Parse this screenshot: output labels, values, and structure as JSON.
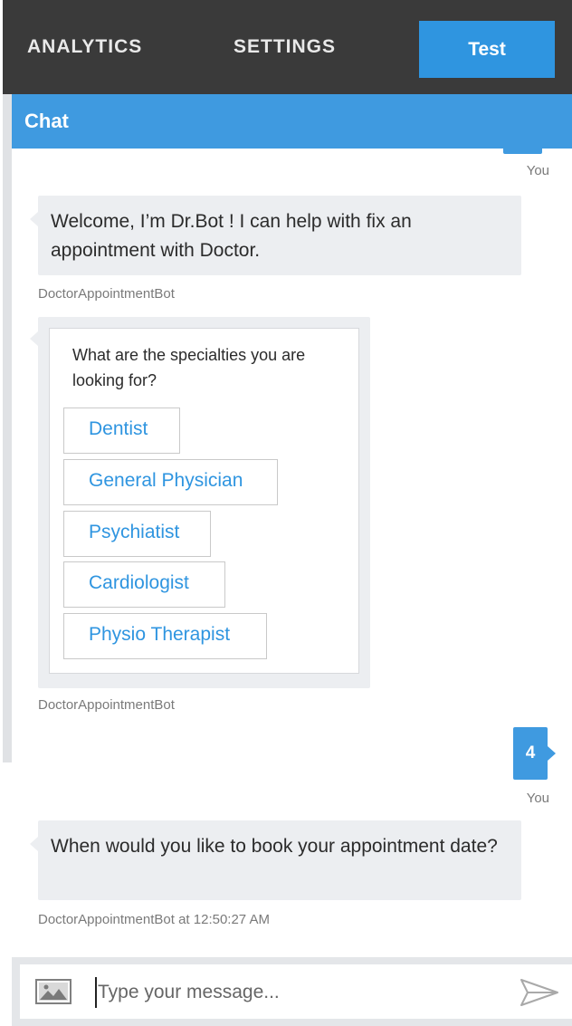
{
  "nav": {
    "analytics_label": "ANALYTICS",
    "settings_label": "SETTINGS",
    "test_label": "Test"
  },
  "chat": {
    "header_title": "Chat",
    "messages": [
      {
        "from": "user",
        "sender_label": "You"
      },
      {
        "from": "bot",
        "text": "Welcome, I’m Dr.Bot ! I can help with fix an appointment with Doctor.",
        "sender_label": "DoctorAppointmentBot"
      },
      {
        "from": "bot",
        "card": {
          "question": "What are the specialties you are looking for?",
          "choices": [
            "Dentist",
            "General Physician",
            "Psychiatist",
            "Cardiologist",
            "Physio Therapist"
          ]
        },
        "sender_label": "DoctorAppointmentBot"
      },
      {
        "from": "user",
        "text": "4",
        "sender_label": "You"
      },
      {
        "from": "bot",
        "text": "When would you like to book your appointment date?",
        "sender_label": "DoctorAppointmentBot at 12:50:27 AM"
      }
    ]
  },
  "input": {
    "placeholder": "Type your message...",
    "image_icon": "image-upload-icon",
    "send_icon": "send-arrow-icon"
  },
  "colors": {
    "accent": "#3f9ae0",
    "topbar": "#3a3a3a",
    "bot_bubble": "#eceef1"
  }
}
